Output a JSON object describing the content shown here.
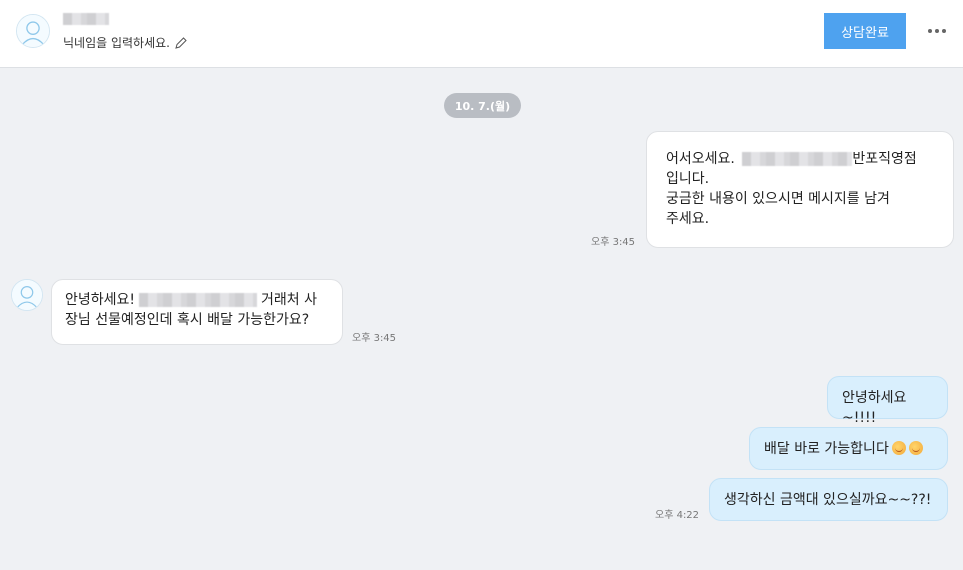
{
  "header": {
    "nickname_prompt": "닉네임을 입력하세요.",
    "done_button": "상담완료",
    "edit_icon": "pencil-icon",
    "more_icon": "more-dots-icon"
  },
  "date_divider": "10. 7.(월)",
  "messages": [
    {
      "side": "outgoing",
      "lines": [
        "어서오세요.",
        "반포직영점",
        "입니다.",
        "궁금한 내용이 있으시면 메시지를 남겨",
        "주세요."
      ],
      "time": "오후 3:45"
    },
    {
      "side": "incoming",
      "lines": [
        "안녕하세요!",
        "거래처 사",
        "장님 선물예정인데 혹시 배달 가능한가요?"
      ],
      "time": "오후 3:45"
    },
    {
      "side": "outgoing",
      "text": "안녕하세요~!!!!"
    },
    {
      "side": "outgoing",
      "text": "배달 바로 가능합니다"
    },
    {
      "side": "outgoing",
      "text": "생각하신 금액대 있으실까요~~??!",
      "time": "오후 4:22"
    }
  ],
  "colors": {
    "accent": "#4ea2ef",
    "outgoing_bubble": "#d9effd",
    "background": "#eff1f4"
  }
}
